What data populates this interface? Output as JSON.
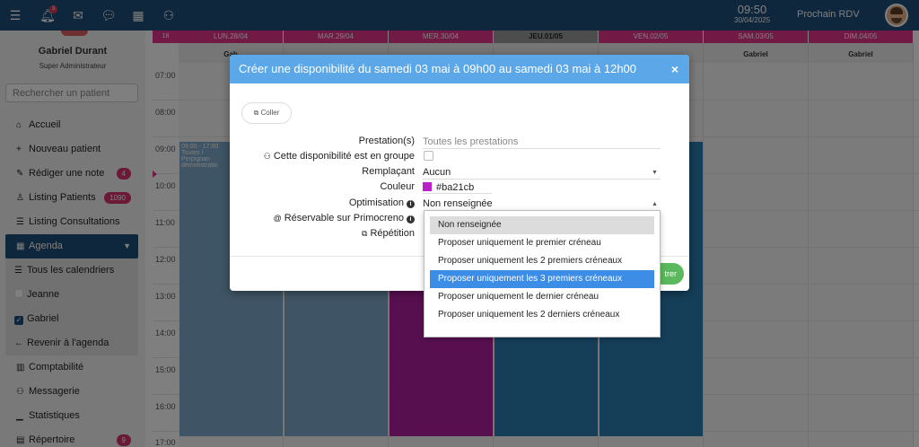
{
  "topbar": {
    "notification_count": "3",
    "time": "09:50",
    "date": "30/04/2025",
    "next_appointment_label": "Prochain RDV"
  },
  "sidebar": {
    "user_name": "Gabriel Durant",
    "user_role": "Super Administrateur",
    "search_placeholder": "Rechercher un patient",
    "items": [
      {
        "label": "Accueil",
        "icon": "home-icon"
      },
      {
        "label": "Nouveau patient",
        "icon": "plus-icon"
      },
      {
        "label": "Rédiger une note",
        "icon": "pen-icon",
        "count": "4"
      },
      {
        "label": "Listing Patients",
        "icon": "user-icon",
        "count": "1090"
      },
      {
        "label": "Listing Consultations",
        "icon": "list-icon"
      },
      {
        "label": "Agenda",
        "icon": "calendar-icon"
      },
      {
        "label": "Tous les calendriers",
        "icon": "list-icon"
      },
      {
        "label": "Jeanne",
        "icon": "checkbox-empty"
      },
      {
        "label": "Gabriel",
        "icon": "checkbox-checked"
      },
      {
        "label": "Revenir à l'agenda",
        "icon": "arrow-left-icon"
      },
      {
        "label": "Comptabilité",
        "icon": "building-icon"
      },
      {
        "label": "Messagerie",
        "icon": "users-icon"
      },
      {
        "label": "Statistiques",
        "icon": "chart-icon"
      },
      {
        "label": "Répertoire",
        "icon": "book-icon",
        "count": "9"
      }
    ]
  },
  "calendar": {
    "week_number": "18",
    "days": [
      "LUN.28/04",
      "MAR.29/04",
      "MER.30/04",
      "JEU.01/05",
      "VEN.02/05",
      "SAM.03/05",
      "DIM.04/05"
    ],
    "practitioner_row": [
      "Gab",
      "",
      "",
      "",
      "",
      "Gabriel",
      "Gabriel"
    ],
    "hours": [
      "07:00",
      "08:00",
      "09:00",
      "10:00",
      "11:00",
      "12:00",
      "13:00",
      "14:00",
      "15:00",
      "16:00",
      "17:00"
    ],
    "event_text": "09:00 - 17:00",
    "event_sub": "Toutes l",
    "event_sub2": "Perpignan",
    "event_sub3": "démonstratio",
    "colors": {
      "event_blue": "#7fa9c9",
      "event_dark": "#2b7cb3",
      "event_pink": "#b01fa0",
      "accent": "#e3358c"
    }
  },
  "modal": {
    "title": "Créer une disponibilité du samedi 03 mai à 09h00 au samedi 03 mai à 12h00",
    "close_label": "×",
    "coller_label": "Coller",
    "fields": {
      "prestation_label": "Prestation(s)",
      "prestation_placeholder": "Toutes les prestations",
      "groupe_label": "Cette disponibilité est en groupe",
      "remplacant_label": "Remplaçant",
      "remplacant_value": "Aucun",
      "couleur_label": "Couleur",
      "couleur_value": "#ba21cb",
      "optimisation_label": "Optimisation",
      "optimisation_value": "Non renseignée",
      "reservable_label": "Réservable sur Primocreno",
      "repetition_label": "Répétition"
    },
    "save_label": "trer"
  },
  "dropdown": {
    "options": [
      "Non renseignée",
      "Proposer uniquement le premier créneau",
      "Proposer uniquement les 2 premiers créneaux",
      "Proposer uniquement les 3 premiers créneaux",
      "Proposer uniquement le dernier créneau",
      "Proposer uniquement les 2 derniers créneaux"
    ],
    "selected": "Non renseignée",
    "highlighted": "Proposer uniquement les 3 premiers créneaux"
  }
}
